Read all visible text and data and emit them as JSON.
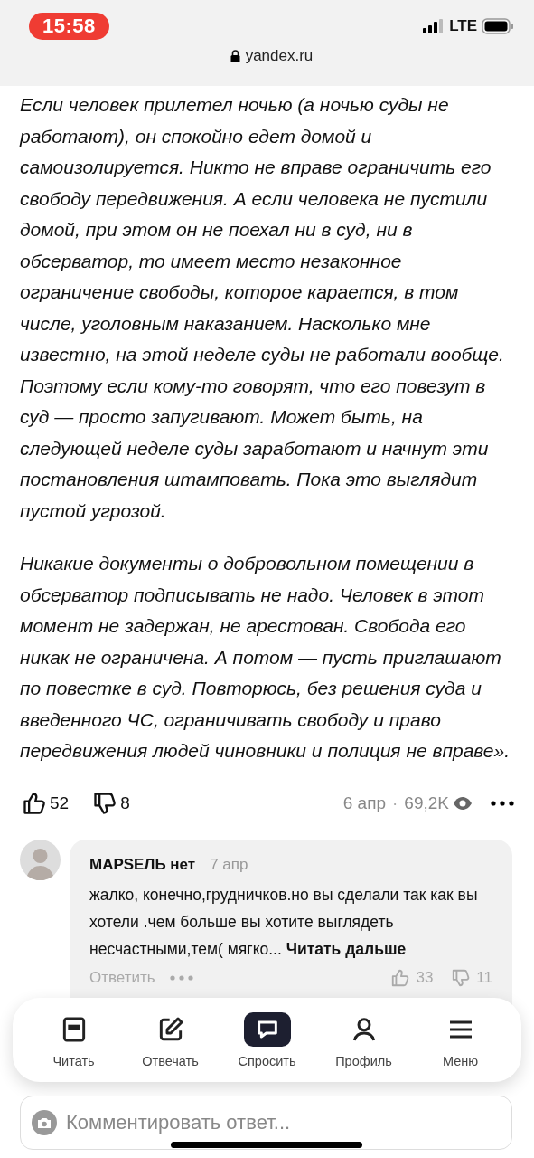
{
  "status_bar": {
    "time": "15:58",
    "network": "LTE",
    "url": "yandex.ru"
  },
  "article": {
    "paragraphs": [
      "Если человек прилетел ночью (а ночью суды не работают), он спокойно едет домой и самоизолируется. Никто не вправе ограничить его свободу передвижения. А если человека не пустили домой, при этом он не поехал ни в суд, ни в обсерватор, то имеет место незаконное ограничение свободы, которое карается, в том числе, уголовным наказанием. Насколько мне известно, на этой неделе суды не работали вообще. Поэтому если кому-то говорят, что его повезут в суд — просто запугивают. Может быть, на следующей неделе суды заработают и начнут эти постановления штамповать. Пока это выглядит пустой угрозой.",
      "Никакие документы о добровольном помещении в обсерватор подписывать не надо. Человек в этот момент не задержан, не арестован. Свобода его никак не ограничена. А потом — пусть приглашают по повестке в суд. Повторюсь, без решения суда и введенного ЧС, ограничивать свободу и право передвижения людей чиновники и полиция не вправе»."
    ]
  },
  "reactions": {
    "likes": "52",
    "dislikes": "8",
    "date": "6 апр",
    "separator": "·",
    "views": "69,2K"
  },
  "comment": {
    "author": "MAPSEЛЬ нет",
    "date": "7 апр",
    "text": "жалко, конечно,грудничков.но вы сделали так как вы хотели .чем больше вы хотите выглядеть несчастными,тем( мягко...",
    "more": "Читать дальше",
    "reply": "Ответить",
    "likes": "33",
    "dislikes": "11"
  },
  "nav": {
    "items": [
      {
        "label": "Читать",
        "kind": "read",
        "selected": false
      },
      {
        "label": "Отвечать",
        "kind": "write",
        "selected": false
      },
      {
        "label": "Спросить",
        "kind": "ask",
        "selected": true
      },
      {
        "label": "Профиль",
        "kind": "profile",
        "selected": false
      },
      {
        "label": "Меню",
        "kind": "menu",
        "selected": false
      }
    ]
  },
  "comment_input": {
    "placeholder": "Комментировать ответ..."
  }
}
